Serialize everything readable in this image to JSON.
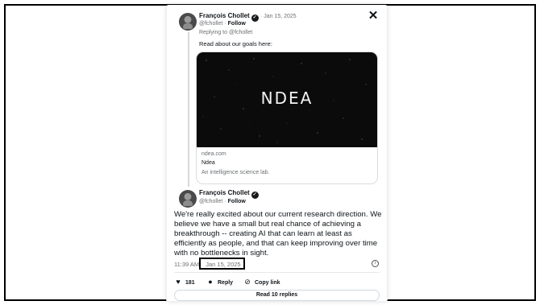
{
  "reply_tweet": {
    "author_name": "François Chollet",
    "handle": "@fchollet",
    "date": "Jan 15, 2025",
    "follow_label": "Follow",
    "replying_to": "Replying to @fchollet",
    "text": "Read about our goals here:",
    "close_icon": "close-icon",
    "link_card": {
      "logo_text": "NDEA",
      "domain": "ndea.com",
      "title": "Ndea",
      "description": "An intelligence science lab."
    }
  },
  "main_tweet": {
    "author_name": "François Chollet",
    "handle": "@fchollet",
    "follow_label": "Follow",
    "text": "We're really excited about our current research direction. We believe we have a small but real chance of achieving a breakthrough -- creating AI that can learn at least as efficiently as people, and that can keep improving over time with no bottlenecks in sight.",
    "time": "11:39 AM",
    "date": "Jan 15, 2025",
    "likes": "181",
    "reply_label": "Reply",
    "copy_link_label": "Copy link",
    "read_replies_label": "Read 10 replies"
  },
  "colors": {
    "text": "#0f1419",
    "muted": "#6b6f73",
    "border": "#d9dde0"
  }
}
